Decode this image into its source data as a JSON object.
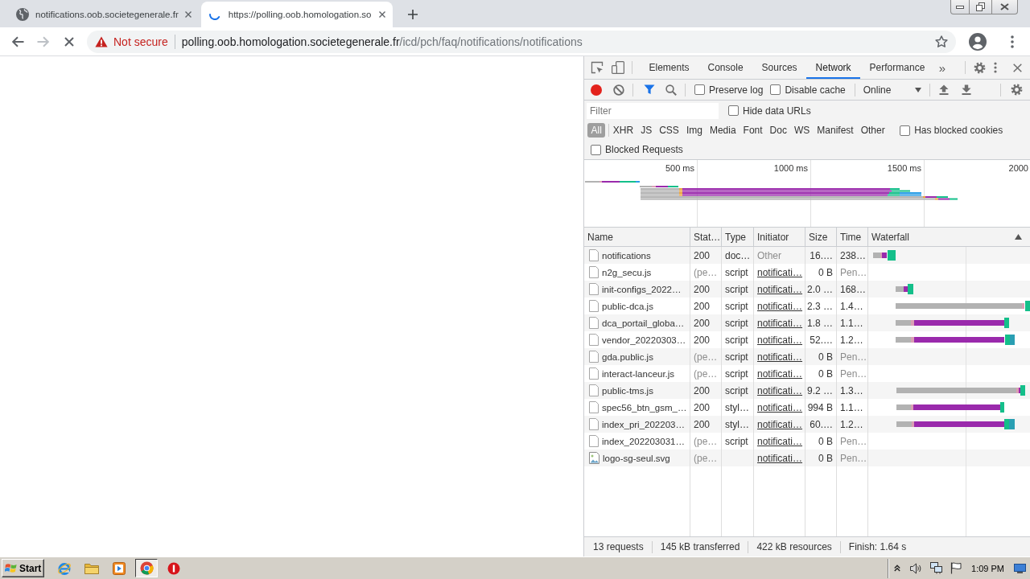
{
  "browser_tabs": [
    {
      "title": "notifications.oob.societegenerale.fr",
      "selected": false,
      "loading": false
    },
    {
      "title": "https://polling.oob.homologation.so",
      "selected": true,
      "loading": true
    }
  ],
  "nav_buttons": [
    {
      "kind": "back",
      "disabled": false
    },
    {
      "kind": "forward",
      "disabled": true
    },
    {
      "kind": "stop",
      "disabled": false
    }
  ],
  "address_bar": {
    "security_label": "Not secure",
    "host": "polling.oob.homologation.societegenerale.fr",
    "path": "/icd/pch/faq/notifications/notifications",
    "bookmarked": false
  },
  "devtools": {
    "tabs": [
      {
        "label": "Elements",
        "selected": false
      },
      {
        "label": "Console",
        "selected": false
      },
      {
        "label": "Sources",
        "selected": false
      },
      {
        "label": "Network",
        "selected": true
      },
      {
        "label": "Performance",
        "selected": false
      }
    ],
    "more_tabs": "»",
    "toolbar": {
      "recording": true,
      "filter_shown": true,
      "preserve_log": {
        "label": "Preserve log",
        "checked": false
      },
      "disable_cache": {
        "label": "Disable cache",
        "checked": false
      },
      "throttling": "Online"
    },
    "filter": {
      "placeholder": "Filter",
      "hide_data_urls": {
        "label": "Hide data URLs",
        "checked": false
      }
    },
    "type_filters": [
      {
        "label": "All",
        "selected": true
      },
      {
        "label": "XHR",
        "selected": false
      },
      {
        "label": "JS",
        "selected": false
      },
      {
        "label": "CSS",
        "selected": false
      },
      {
        "label": "Img",
        "selected": false
      },
      {
        "label": "Media",
        "selected": false
      },
      {
        "label": "Font",
        "selected": false
      },
      {
        "label": "Doc",
        "selected": false
      },
      {
        "label": "WS",
        "selected": false
      },
      {
        "label": "Manifest",
        "selected": false
      },
      {
        "label": "Other",
        "selected": false
      }
    ],
    "has_blocked_cookies": {
      "label": "Has blocked cookies",
      "checked": false
    },
    "blocked_requests": {
      "label": "Blocked Requests",
      "checked": false
    },
    "overview": {
      "ticks": [
        "500 ms",
        "1000 ms",
        "1500 ms",
        "2000"
      ]
    },
    "table": {
      "columns": [
        {
          "label": "Name",
          "sorted": false
        },
        {
          "label": "Stat…",
          "sorted": false
        },
        {
          "label": "Type",
          "sorted": false
        },
        {
          "label": "Initiator",
          "sorted": false
        },
        {
          "label": "Size",
          "sorted": false
        },
        {
          "label": "Time",
          "sorted": false
        },
        {
          "label": "Waterfall",
          "sorted": true
        }
      ],
      "rows": [
        {
          "kind": "document",
          "name": "notifications",
          "status": "200",
          "pending": false,
          "type": "doc…",
          "initiator": "Other",
          "initiator_link": false,
          "size": "16.…",
          "time": "238…"
        },
        {
          "kind": "document",
          "name": "n2g_secu.js",
          "status": "(pe…",
          "pending": true,
          "type": "script",
          "initiator": "notificati…",
          "initiator_link": true,
          "size": "0 B",
          "time": "Pen…"
        },
        {
          "kind": "document",
          "name": "init-configs_2022…",
          "status": "200",
          "pending": false,
          "type": "script",
          "initiator": "notificati…",
          "initiator_link": true,
          "size": "2.0 …",
          "time": "168…"
        },
        {
          "kind": "document",
          "name": "public-dca.js",
          "status": "200",
          "pending": false,
          "type": "script",
          "initiator": "notificati…",
          "initiator_link": true,
          "size": "2.3 …",
          "time": "1.4…"
        },
        {
          "kind": "document",
          "name": "dca_portail_globa…",
          "status": "200",
          "pending": false,
          "type": "script",
          "initiator": "notificati…",
          "initiator_link": true,
          "size": "1.8 …",
          "time": "1.1…"
        },
        {
          "kind": "document",
          "name": "vendor_20220303…",
          "status": "200",
          "pending": false,
          "type": "script",
          "initiator": "notificati…",
          "initiator_link": true,
          "size": "52.…",
          "time": "1.2…"
        },
        {
          "kind": "document",
          "name": "gda.public.js",
          "status": "(pe…",
          "pending": true,
          "type": "script",
          "initiator": "notificati…",
          "initiator_link": true,
          "size": "0 B",
          "time": "Pen…"
        },
        {
          "kind": "document",
          "name": "interact-lanceur.js",
          "status": "(pe…",
          "pending": true,
          "type": "script",
          "initiator": "notificati…",
          "initiator_link": true,
          "size": "0 B",
          "time": "Pen…"
        },
        {
          "kind": "document",
          "name": "public-tms.js",
          "status": "200",
          "pending": false,
          "type": "script",
          "initiator": "notificati…",
          "initiator_link": true,
          "size": "9.2 …",
          "time": "1.3…"
        },
        {
          "kind": "document",
          "name": "spec56_btn_gsm_…",
          "status": "200",
          "pending": false,
          "type": "styl…",
          "initiator": "notificati…",
          "initiator_link": true,
          "size": "994 B",
          "time": "1.1…"
        },
        {
          "kind": "document",
          "name": "index_pri_202203…",
          "status": "200",
          "pending": false,
          "type": "styl…",
          "initiator": "notificati…",
          "initiator_link": true,
          "size": "60.…",
          "time": "1.2…"
        },
        {
          "kind": "document",
          "name": "index_202203031…",
          "status": "(pe…",
          "pending": true,
          "type": "script",
          "initiator": "notificati…",
          "initiator_link": true,
          "size": "0 B",
          "time": "Pen…"
        },
        {
          "kind": "image",
          "name": "logo-sg-seul.svg",
          "status": "(pe…",
          "pending": true,
          "initiator": "notificati…",
          "initiator_link": true,
          "size": "0 B",
          "time": "Pen…"
        }
      ]
    },
    "status_bar": [
      "13 requests",
      "145 kB transferred",
      "422 kB resources",
      "Finish: 1.64 s"
    ]
  },
  "taskbar": {
    "start_label": "Start",
    "apps": [
      {
        "kind": "e_browser",
        "selected": false
      },
      {
        "kind": "folder",
        "selected": false
      },
      {
        "kind": "media_player",
        "selected": false
      },
      {
        "kind": "round_browser",
        "selected": true
      },
      {
        "kind": "red_circle",
        "selected": false
      }
    ],
    "clock": "1:09 PM"
  }
}
